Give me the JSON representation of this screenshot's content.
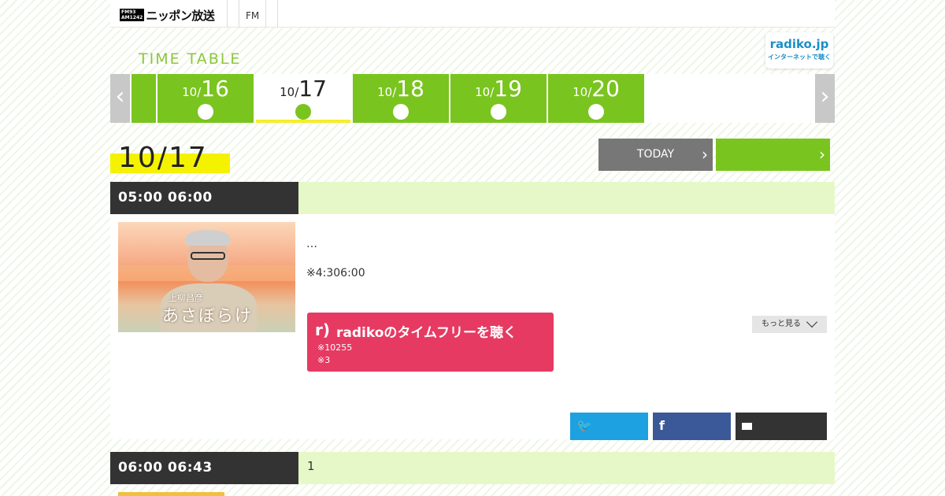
{
  "header": {
    "logo_badge_top": "FM93",
    "logo_badge_bottom": "AM1242",
    "logo_name": "ニッポン放送",
    "nav": [
      "FM"
    ],
    "radiko_top": "radiko.jp",
    "radiko_bottom": "インターネットで聴く"
  },
  "timetable": {
    "title": "TIME TABLE",
    "prev_arrow": "‹",
    "next_arrow": "›",
    "dates": [
      {
        "month": "10/",
        "day": "16"
      },
      {
        "month": "10/",
        "day": "17"
      },
      {
        "month": "10/",
        "day": "18"
      },
      {
        "month": "10/",
        "day": "19"
      },
      {
        "month": "10/",
        "day": "20"
      }
    ],
    "active_index": 1
  },
  "current": {
    "date": "10/17",
    "today_label": "TODAY"
  },
  "programs": [
    {
      "time": "05:00  06:00",
      "title": "",
      "thumb_line1": "上柳昌彦",
      "thumb_line2": "あさぼらけ",
      "desc1": "…",
      "desc2": "※4:306:00",
      "radiko_label": "radikoのタイムフリーを聴く",
      "radiko_note1": "※10255",
      "radiko_note2": "※3",
      "more_label": "もっと見る"
    },
    {
      "time": "06:00  06:43",
      "title": "1"
    }
  ],
  "colors": {
    "accent_green": "#7ac41f",
    "radiko_pink": "#e63a62",
    "twitter": "#1da1e0",
    "facebook": "#3b5998"
  }
}
